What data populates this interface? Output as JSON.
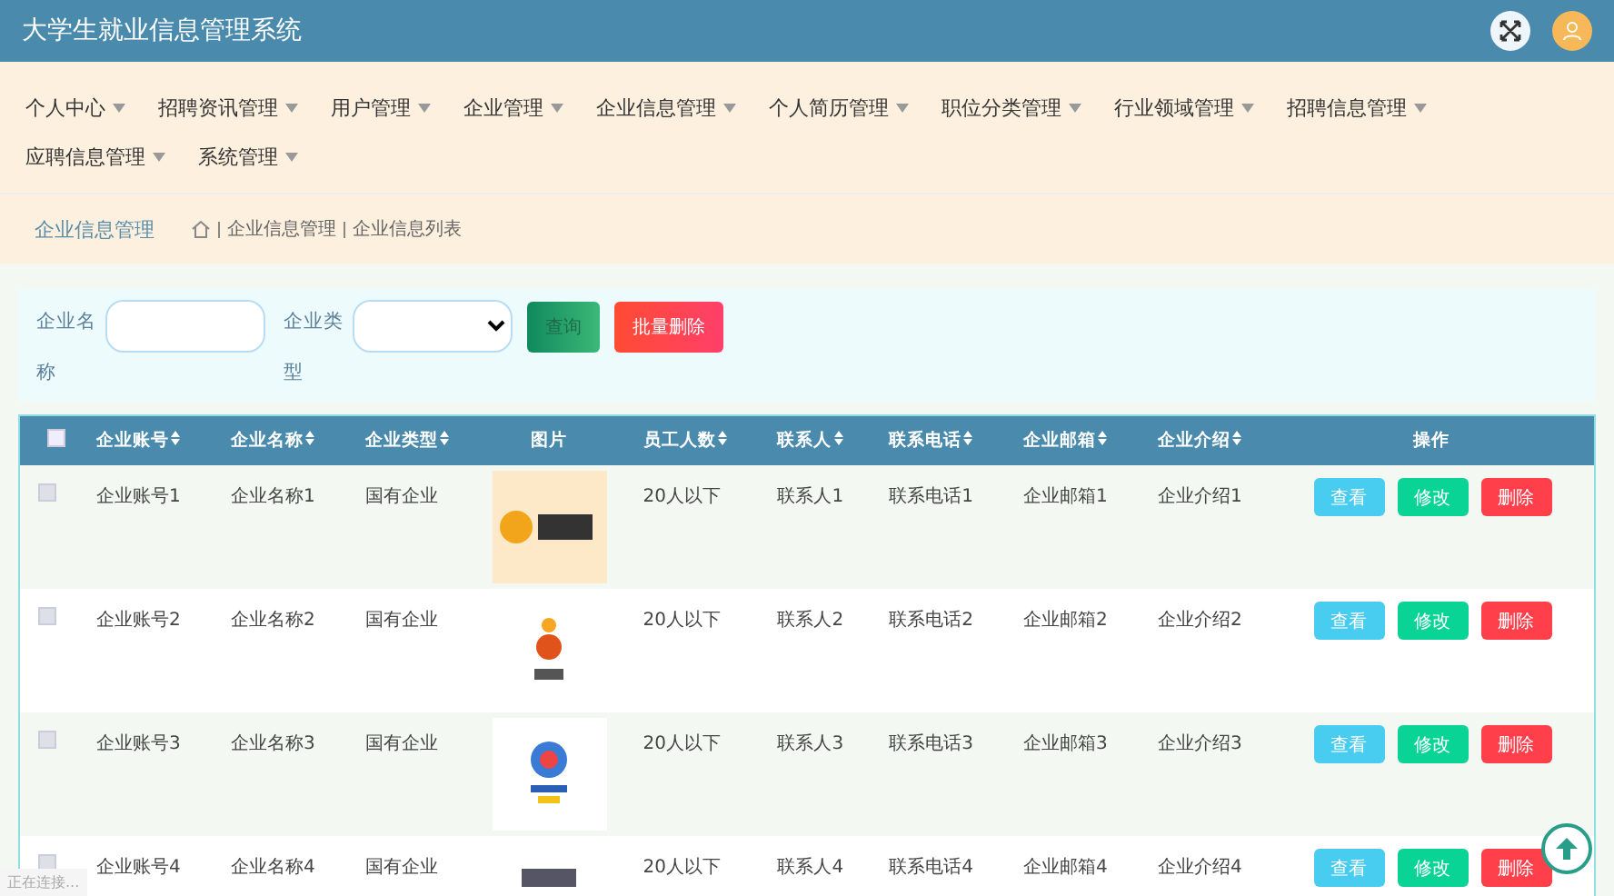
{
  "window": {
    "title": "大学生就业信息管理系统"
  },
  "nav": [
    {
      "label": "个人中心"
    },
    {
      "label": "招聘资讯管理"
    },
    {
      "label": "用户管理"
    },
    {
      "label": "企业管理"
    },
    {
      "label": "企业信息管理"
    },
    {
      "label": "个人简历管理"
    },
    {
      "label": "职位分类管理"
    },
    {
      "label": "行业领域管理"
    },
    {
      "label": "招聘信息管理"
    },
    {
      "label": "应聘信息管理"
    },
    {
      "label": "系统管理"
    }
  ],
  "breadcrumb": {
    "title": "企业信息管理",
    "path": [
      "企业信息管理",
      "企业信息列表"
    ]
  },
  "search": {
    "fields": [
      {
        "label": "企业名称",
        "kind": "text"
      },
      {
        "label": "企业类型",
        "kind": "select"
      }
    ],
    "buttons": [
      {
        "label": "查询",
        "kind": "search"
      },
      {
        "label": "批量删除",
        "kind": "danger"
      }
    ]
  },
  "table": {
    "select_all": {
      "checked": false
    },
    "columns": [
      {
        "label": "企业账号",
        "sortable": true
      },
      {
        "label": "企业名称",
        "sortable": true
      },
      {
        "label": "企业类型",
        "sortable": true
      },
      {
        "label": "图片",
        "sortable": false,
        "kind": "image"
      },
      {
        "label": "员工人数",
        "sortable": true
      },
      {
        "label": "联系人",
        "sortable": true
      },
      {
        "label": "联系电话",
        "sortable": true
      },
      {
        "label": "企业邮箱",
        "sortable": true
      },
      {
        "label": "企业介绍",
        "sortable": true
      },
      {
        "label": "操作",
        "sortable": false
      }
    ],
    "rows": [
      {
        "checked": false,
        "cells": [
          "企业账号1",
          "企业名称1",
          "国有企业",
          "",
          "20人以下",
          "联系人1",
          "联系电话1",
          "企业邮箱1",
          "企业介绍1"
        ],
        "actions": [
          {
            "label": "查看",
            "kind": "view"
          },
          {
            "label": "修改",
            "kind": "edit"
          },
          {
            "label": "删除",
            "kind": "delete"
          }
        ]
      },
      {
        "checked": false,
        "cells": [
          "企业账号2",
          "企业名称2",
          "国有企业",
          "",
          "20人以下",
          "联系人2",
          "联系电话2",
          "企业邮箱2",
          "企业介绍2"
        ],
        "actions": [
          {
            "label": "查看",
            "kind": "view"
          },
          {
            "label": "修改",
            "kind": "edit"
          },
          {
            "label": "删除",
            "kind": "delete"
          }
        ]
      },
      {
        "checked": false,
        "cells": [
          "企业账号3",
          "企业名称3",
          "国有企业",
          "",
          "20人以下",
          "联系人3",
          "联系电话3",
          "企业邮箱3",
          "企业介绍3"
        ],
        "actions": [
          {
            "label": "查看",
            "kind": "view"
          },
          {
            "label": "修改",
            "kind": "edit"
          },
          {
            "label": "删除",
            "kind": "delete"
          }
        ]
      },
      {
        "checked": false,
        "cells": [
          "企业账号4",
          "企业名称4",
          "国有企业",
          "",
          "20人以下",
          "联系人4",
          "联系电话4",
          "企业邮箱4",
          "企业介绍4"
        ],
        "actions": [
          {
            "label": "查看",
            "kind": "view"
          },
          {
            "label": "修改",
            "kind": "edit"
          },
          {
            "label": "删除",
            "kind": "delete"
          }
        ]
      }
    ]
  },
  "status_text": "正在连接..."
}
